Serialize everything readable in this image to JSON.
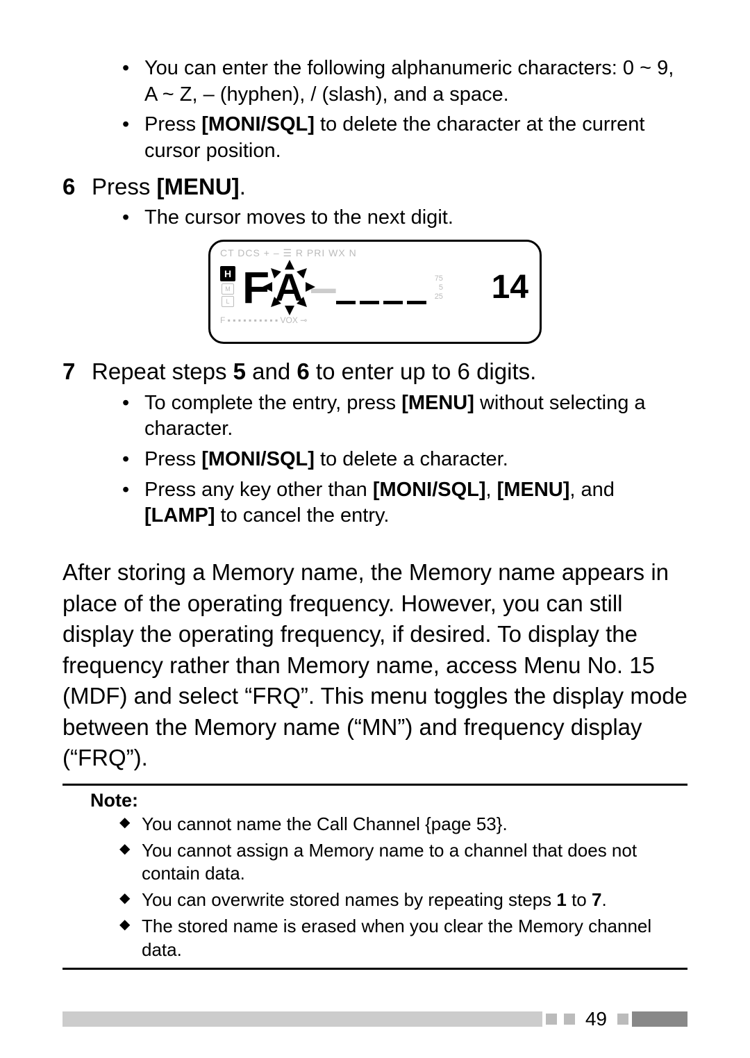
{
  "steps_initial_sub": [
    {
      "text": "You can enter the following alphanumeric characters: 0 ~ 9, A ~ Z, – (hyphen), / (slash), and a space."
    },
    {
      "html": "Press <b>[MONI/SQL]</b> to delete the character at the current cursor position."
    }
  ],
  "step6": {
    "num": "6",
    "html": "Press <b>[MENU]</b>.",
    "sub": [
      {
        "text": "The cursor moves to the next digit."
      }
    ]
  },
  "figure": {
    "top_row": "CT    DCS    +  –  ☰  R     PRI WX N",
    "H": "H",
    "M": "M",
    "L": "L",
    "big1": "F",
    "burst": "A",
    "right": "14",
    "side_nums": [
      "75",
      "5",
      "25"
    ],
    "bottom_row": "F  ▪ ▪ ▪ ▪ ▪ ▪ ▪ ▪ ▪ ▪    VOX  ⊸"
  },
  "step7": {
    "num": "7",
    "html": "Repeat steps <b>5</b> and <b>6</b> to enter up to 6 digits.",
    "sub": [
      {
        "html": "To complete the entry, press <b>[MENU]</b> without selecting a character."
      },
      {
        "html": "Press <b>[MONI/SQL]</b> to delete a character."
      },
      {
        "html": "Press any key other than <b>[MONI/SQL]</b>, <b>[MENU]</b>, and <b>[LAMP]</b> to cancel the entry."
      }
    ]
  },
  "paragraph": "After storing a Memory name, the Memory name appears in place of the operating frequency.  However, you can still display the operating frequency, if desired.  To display the frequency rather than Memory name, access Menu No. 15 (MDF) and select “FRQ”.  This menu toggles the display mode between the Memory name (“MN”) and frequency display (“FRQ”).",
  "note": {
    "title": "Note:",
    "items": [
      {
        "text": "You cannot name the Call Channel {page 53}."
      },
      {
        "text": "You cannot assign a Memory name to a channel that does not contain data."
      },
      {
        "html": "You can overwrite stored names by repeating steps <b>1</b> to <b>7</b>."
      },
      {
        "text": "The stored name is erased when you clear the Memory channel data."
      }
    ]
  },
  "page_number": "49"
}
